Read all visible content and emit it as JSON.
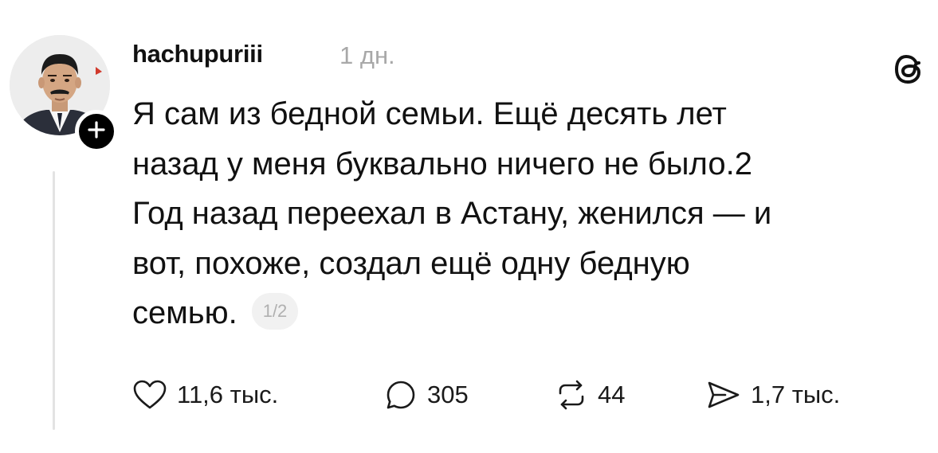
{
  "post": {
    "username": "hachupuriii",
    "time_ago": "1 дн.",
    "text_lines": [
      "Я сам из бедной семьи. Ещё десять лет",
      "назад у меня буквально ничего не было.2",
      "Год назад переехал в Астану, женился — и",
      "вот, похоже, создал ещё одну бедную",
      "семью."
    ],
    "page_indicator": "1/2"
  },
  "actions": {
    "likes": "11,6 тыс.",
    "replies": "305",
    "reposts": "44",
    "shares": "1,7 тыс."
  },
  "icons": {
    "avatar": "user-avatar-photo",
    "follow": "plus-icon",
    "logo": "threads-logo-icon",
    "like": "heart-icon",
    "reply": "comment-bubble-icon",
    "repost": "repost-arrows-icon",
    "share": "send-icon"
  }
}
